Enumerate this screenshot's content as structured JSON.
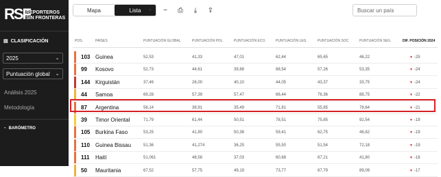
{
  "sidebar": {
    "logo_mark": "RSF",
    "logo_line1": "REPORTEROS",
    "logo_line2": "SIN FRONTERAS",
    "section_title": "CLASIFICACIÓN",
    "year_select": "2025",
    "metric_select": "Puntuación global",
    "link_analysis": "Análisis 2025",
    "link_method": "Metodología",
    "barometer": "BARÓMETRO"
  },
  "toolbar": {
    "tab_map": "Mapa",
    "tab_list": "Lista",
    "search_placeholder": "Buscar un país"
  },
  "table": {
    "headers": {
      "pos": "POS.",
      "country": "PAÍSES",
      "global": "PUNTUACIÓN GLOBAL",
      "pol": "PUNTUACIÓN POL.",
      "eco": "PUNTUACIÓN ECO.",
      "leg": "PUNTUACIÓN LEG.",
      "soc": "PUNTUACIÓN SOC.",
      "seg": "PUNTUACIÓN SEG.",
      "dif": "DIF. POSICIÓN 2024"
    },
    "rows": [
      {
        "pos": "103",
        "country": "Guinea",
        "global": "52,53",
        "pol": "41,33",
        "eco": "47,01",
        "leg": "62,44",
        "soc": "65,65",
        "seg": "46,22",
        "dif": "-25",
        "color": "#e8713c"
      },
      {
        "pos": "99",
        "country": "Kosovo",
        "global": "52,73",
        "pol": "44,61",
        "eco": "39,88",
        "leg": "68,54",
        "soc": "57,26",
        "seg": "53,35",
        "dif": "-24",
        "color": "#e8713c"
      },
      {
        "pos": "144",
        "country": "Kirguistán",
        "global": "37,46",
        "pol": "26,00",
        "eco": "40,10",
        "leg": "44,05",
        "soc": "43,37",
        "seg": "33,75",
        "dif": "-24",
        "color": "#c0392b"
      },
      {
        "pos": "44",
        "country": "Samoa",
        "global": "69,28",
        "pol": "57,39",
        "eco": "57,47",
        "leg": "66,44",
        "soc": "76,36",
        "seg": "88,75",
        "dif": "-22",
        "color": "#f2b13a"
      },
      {
        "pos": "87",
        "country": "Argentina",
        "global": "56,14",
        "pol": "38,91",
        "eco": "35,49",
        "leg": "71,81",
        "soc": "55,85",
        "seg": "78,64",
        "dif": "-21",
        "color": "#e8713c"
      },
      {
        "pos": "39",
        "country": "Timor Oriental",
        "global": "71,79",
        "pol": "61,44",
        "eco": "50,51",
        "leg": "78,51",
        "soc": "75,85",
        "seg": "92,54",
        "dif": "-19",
        "color": "#f2d13a"
      },
      {
        "pos": "105",
        "country": "Burkina Faso",
        "global": "53,25",
        "pol": "41,90",
        "eco": "50,38",
        "leg": "59,41",
        "soc": "62,75",
        "seg": "46,82",
        "dif": "-19",
        "color": "#e8713c"
      },
      {
        "pos": "110",
        "country": "Guinea Bissau",
        "global": "51,36",
        "pol": "41,274",
        "eco": "36,25",
        "leg": "55,50",
        "soc": "51,54",
        "seg": "72,18",
        "dif": "-19",
        "color": "#e8713c"
      },
      {
        "pos": "111",
        "country": "Haití",
        "global": "51,061",
        "pol": "48,58",
        "eco": "37,03",
        "leg": "60,68",
        "soc": "67,21",
        "seg": "41,80",
        "dif": "-18",
        "color": "#e8713c"
      },
      {
        "pos": "50",
        "country": "Mauritania",
        "global": "67,52",
        "pol": "57,75",
        "eco": "49,19",
        "leg": "73,77",
        "soc": "67,79",
        "seg": "89,09",
        "dif": "-17",
        "color": "#f2b13a"
      }
    ]
  }
}
